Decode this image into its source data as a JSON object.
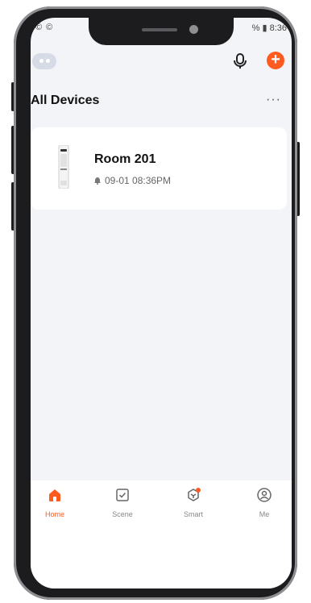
{
  "status_bar": {
    "left": "© ©",
    "right": "% ▮ 8:36"
  },
  "header": {
    "title": "All Devices",
    "more": "···",
    "add": "+"
  },
  "devices": [
    {
      "name": "Room 201",
      "status": "09-01 08:36PM"
    }
  ],
  "tabbar": {
    "tabs": [
      {
        "label": "Home",
        "icon": "home-icon",
        "active": true
      },
      {
        "label": "Scene",
        "icon": "scene-icon",
        "active": false
      },
      {
        "label": "Smart",
        "icon": "smart-icon",
        "active": false
      },
      {
        "label": "Me",
        "icon": "me-icon",
        "active": false
      }
    ]
  },
  "colors": {
    "accent": "#ff5a1f",
    "background": "#f3f4f7",
    "frame": "#1c1c1e"
  }
}
